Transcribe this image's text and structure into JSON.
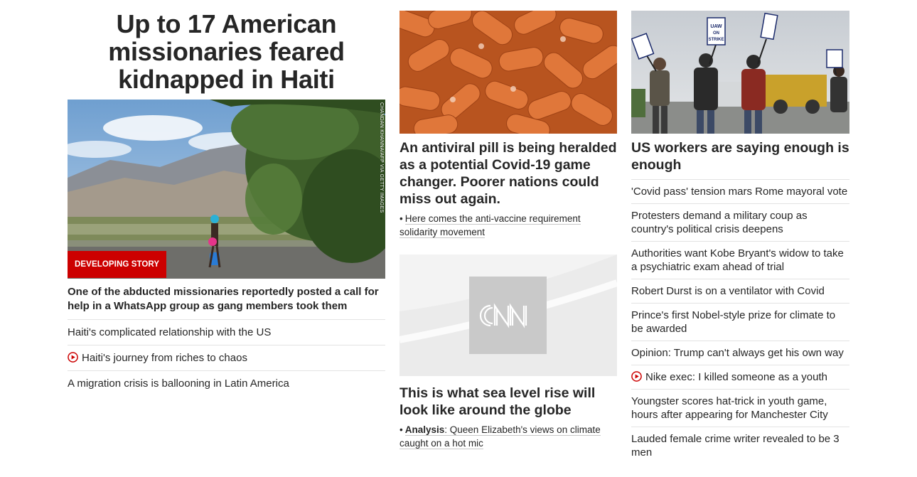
{
  "lead": {
    "headline_lines": [
      "Up to 17 American",
      "missionaries feared",
      "kidnapped in Haiti"
    ],
    "image_credit": "CHANDAN KHANNA/AFP VIA GETTY IMAGES",
    "badge": "DEVELOPING STORY",
    "summary": "One of the abducted missionaries reportedly posted a call for help in a WhatsApp group as gang members took them",
    "links": [
      {
        "text": "Haiti's complicated relationship with the US",
        "video": false
      },
      {
        "text": "Haiti's journey from riches to chaos",
        "video": true
      },
      {
        "text": "A migration crisis is ballooning in Latin America",
        "video": false
      }
    ]
  },
  "middle": {
    "story1": {
      "headline": "An antiviral pill is being heralded as a potential Covid-19 game changer. Poorer nations could miss out again.",
      "related": "Here comes the anti-vaccine requirement solidarity movement"
    },
    "story2": {
      "logo": "CNN",
      "headline": "This is what sea level rise will look like around the globe",
      "related_prefix": "Analysis",
      "related": "Queen Elizabeth's views on climate caught on a hot mic"
    }
  },
  "right": {
    "headline": "US workers are saying enough is enough",
    "links": [
      {
        "text": "'Covid pass' tension mars Rome mayoral vote",
        "video": false
      },
      {
        "text": "Protesters demand a military coup as country's political crisis deepens",
        "video": false
      },
      {
        "text": "Authorities want Kobe Bryant's widow to take a psychiatric exam ahead of trial",
        "video": false
      },
      {
        "text": "Robert Durst is on a ventilator with Covid",
        "video": false
      },
      {
        "text": "Prince's first Nobel-style prize for climate to be awarded",
        "video": false
      },
      {
        "text": "Opinion: Trump can't always get his own way",
        "video": false
      },
      {
        "text": "Nike exec: I killed someone as a youth",
        "video": true
      },
      {
        "text": "Youngster scores hat-trick in youth game, hours after appearing for Manchester City",
        "video": false
      },
      {
        "text": "Lauded female crime writer revealed to be 3 men",
        "video": false
      }
    ],
    "sign_text": [
      "UAW",
      "ON",
      "STRIKE"
    ]
  },
  "colors": {
    "badge": "#cc0000",
    "text": "#262626",
    "divider": "#e3e3e3",
    "play": "#cc0000"
  },
  "icons": {
    "video": "play-circle-icon"
  }
}
